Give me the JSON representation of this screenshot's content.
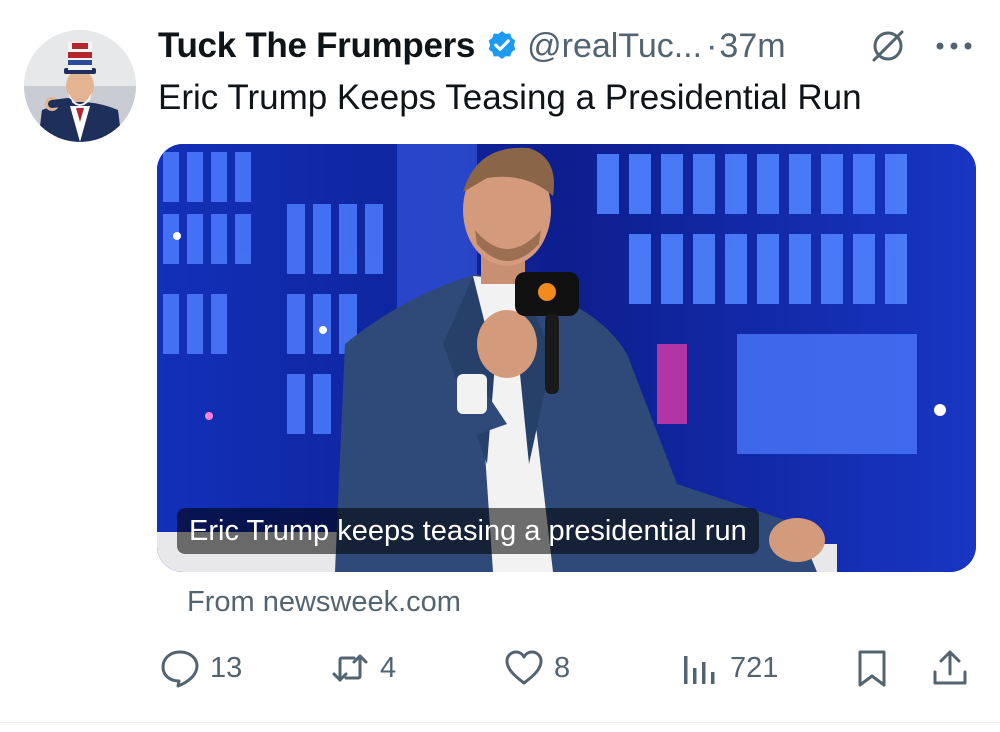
{
  "tweet": {
    "author_name": "Tuck The Frumpers",
    "handle": "@realTuc...",
    "separator": "·",
    "time": "37m",
    "text": "Eric Trump Keeps Teasing a Presidential Run"
  },
  "card": {
    "caption": "Eric Trump keeps teasing a presidential run",
    "source": "From newsweek.com"
  },
  "actions": {
    "replies": "13",
    "reposts": "4",
    "likes": "8",
    "views": "721"
  },
  "colors": {
    "verified": "#1d9bf0",
    "muted": "#536471",
    "text": "#0f1419"
  },
  "icons": {
    "verified": "verified-badge-icon",
    "grok": "grok-icon",
    "more": "more-horizontal-icon",
    "reply": "reply-icon",
    "repost": "repost-icon",
    "like": "heart-icon",
    "views": "views-chart-icon",
    "bookmark": "bookmark-icon",
    "share": "share-icon"
  }
}
